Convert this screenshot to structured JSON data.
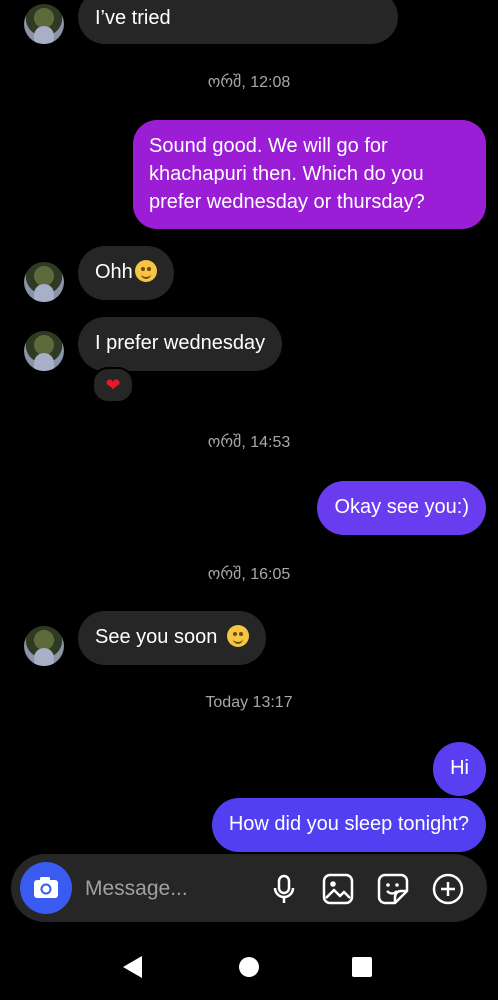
{
  "messages": [
    {
      "type": "incoming",
      "text": "I’ve tried"
    },
    {
      "type": "timestamp",
      "text": "ორშ, 12:08"
    },
    {
      "type": "outgoing",
      "lines": [
        "Sound good. We will go for",
        "khachapuri then. Which do you",
        "prefer wednesday or thursday?"
      ],
      "color": "#9b1ed6"
    },
    {
      "type": "incoming",
      "text": "Ohh"
    },
    {
      "type": "incoming",
      "text": "I prefer wednesday",
      "reaction": "❤"
    },
    {
      "type": "timestamp",
      "text": "ორშ, 14:53"
    },
    {
      "type": "outgoing",
      "text": "Okay see you:)",
      "color": "#6a3cf0"
    },
    {
      "type": "timestamp",
      "text": "ორშ, 16:05"
    },
    {
      "type": "incoming",
      "text": "See you soon"
    },
    {
      "type": "timestamp",
      "text": "Today 13:17"
    },
    {
      "type": "outgoing",
      "text": "Hi",
      "color": "#5a3ff2"
    },
    {
      "type": "outgoing",
      "text": "How did you sleep tonight?",
      "color": "#5040f2"
    }
  ],
  "composer": {
    "placeholder": "Message...",
    "icons": [
      "camera-icon",
      "microphone-icon",
      "gallery-icon",
      "sticker-icon",
      "add-icon"
    ],
    "camera_color": "#3a5bf0"
  },
  "navbar": {
    "icons": [
      "back-icon",
      "home-icon",
      "recents-icon"
    ]
  },
  "colors": {
    "background": "#000000",
    "incoming_bubble": "#262626",
    "timestamp": "#a8a8a8"
  }
}
